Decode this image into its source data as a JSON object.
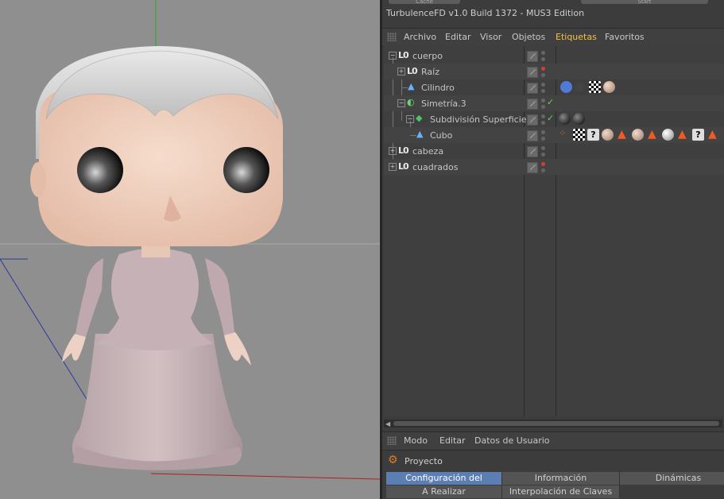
{
  "top_buttons": [
    "Cache",
    "Start"
  ],
  "plugin_title": "TurbulenceFD v1.0 Build 1372 - MUS3 Edition",
  "objects_menu": [
    "Archivo",
    "Editar",
    "Visor",
    "Objetos",
    "Etiquetas",
    "Favoritos"
  ],
  "objects_menu_active": "Etiquetas",
  "objects": [
    {
      "name": "cuerpo",
      "icon": "null-icon"
    },
    {
      "name": "Raíz",
      "icon": "null-icon"
    },
    {
      "name": "Cilindro",
      "icon": "polygon-icon"
    },
    {
      "name": "Simetría.3",
      "icon": "symmetry-icon"
    },
    {
      "name": "Subdivisión Superficie",
      "icon": "subdivision-icon"
    },
    {
      "name": "Cubo",
      "icon": "polygon-icon"
    },
    {
      "name": "cabeza",
      "icon": "null-icon"
    },
    {
      "name": "cuadrados",
      "icon": "null-icon"
    }
  ],
  "attr_menu": [
    "Modo",
    "Editar",
    "Datos de Usuario"
  ],
  "attr_title": "Proyecto",
  "attr_tabs": [
    "Configuración del Proyecto",
    "Información",
    "Dinámicas",
    "A Realizar",
    "Interpolación de Claves"
  ],
  "attr_tab_active": "Configuración del Proyecto",
  "colors": {
    "active_menu": "#f2c246",
    "active_tab": "#5c7fb3",
    "viewport_bg": "#8f8f8f"
  }
}
